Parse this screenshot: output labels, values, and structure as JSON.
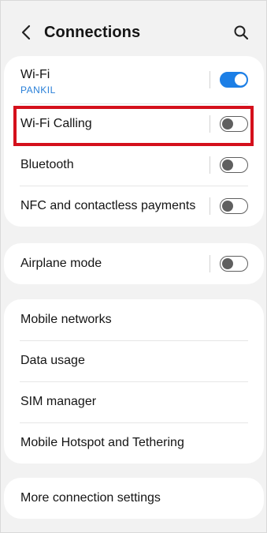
{
  "header": {
    "title": "Connections",
    "back_icon": "chevron-left-icon",
    "search_icon": "search-icon"
  },
  "group1": {
    "items": [
      {
        "label": "Wi-Fi",
        "sublabel": "PANKIL",
        "toggle": "on"
      },
      {
        "label": "Wi-Fi Calling",
        "toggle": "off",
        "highlighted": true
      },
      {
        "label": "Bluetooth",
        "toggle": "off"
      },
      {
        "label": "NFC and contactless payments",
        "toggle": "off"
      }
    ]
  },
  "group2": {
    "items": [
      {
        "label": "Airplane mode",
        "toggle": "off"
      }
    ]
  },
  "group3": {
    "items": [
      {
        "label": "Mobile networks"
      },
      {
        "label": "Data usage"
      },
      {
        "label": "SIM manager"
      },
      {
        "label": "Mobile Hotspot and Tethering"
      }
    ]
  },
  "group4": {
    "items": [
      {
        "label": "More connection settings"
      }
    ]
  },
  "colors": {
    "accent": "#1c7fe6",
    "sublabel": "#2a80d8",
    "highlight": "#d4101c",
    "background": "#f2f2f2",
    "card": "#ffffff"
  }
}
